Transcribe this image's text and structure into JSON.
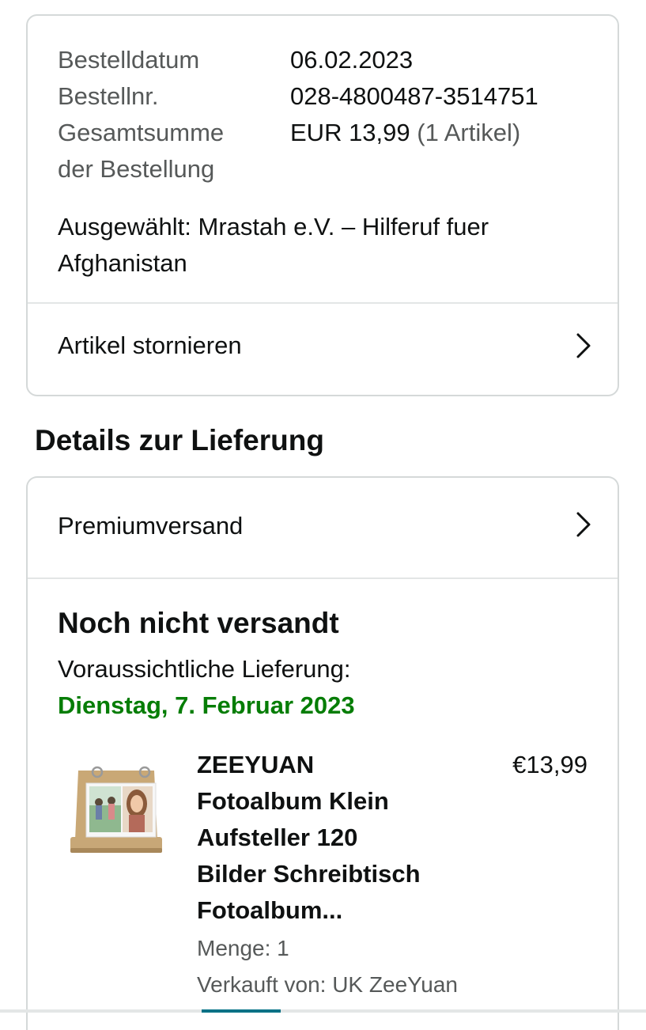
{
  "order_summary": {
    "date_label": "Bestelldatum",
    "date_value": "06.02.2023",
    "number_label": "Bestellnr.",
    "number_value": "028-4800487-3514751",
    "total_label_line1": "Gesamtsumme",
    "total_label_line2": "der Bestellung",
    "total_value": "EUR 13,99",
    "total_count": "(1 Artikel)",
    "charity_line1": "Ausgewählt: Mrastah e.V. – Hilferuf fuer",
    "charity_line2": "Afghanistan",
    "cancel_label": "Artikel stornieren"
  },
  "delivery": {
    "heading": "Details zur Lieferung",
    "shipping_option": "Premiumversand",
    "status": "Noch nicht versandt",
    "eta_label": "Voraussichtliche Lieferung:",
    "eta_date": "Dienstag, 7. Februar 2023",
    "product": {
      "title_lines": [
        "ZEEYUAN",
        "Fotoalbum Klein",
        "Aufsteller 120",
        "Bilder Schreibtisch",
        "Fotoalbum..."
      ],
      "price": "€13,99",
      "quantity": "Menge: 1",
      "seller": "Verkauft von: UK ZeeYuan"
    }
  },
  "colors": {
    "accent_green": "#067d06",
    "border": "#d5d9d9",
    "muted_text": "#565959"
  },
  "icons": {
    "chevron": "chevron-right-icon"
  }
}
